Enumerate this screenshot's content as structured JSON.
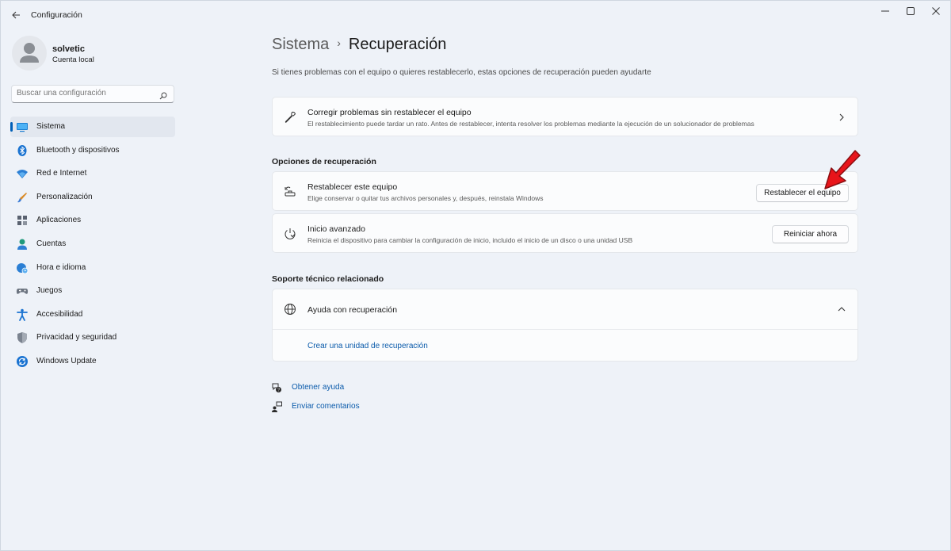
{
  "window": {
    "title": "Configuración"
  },
  "profile": {
    "name": "solvetic",
    "account_type": "Cuenta local"
  },
  "search": {
    "placeholder": "Buscar una configuración"
  },
  "sidebar": {
    "items": [
      {
        "label": "Sistema",
        "icon": "system-icon",
        "active": true
      },
      {
        "label": "Bluetooth y dispositivos",
        "icon": "bluetooth-icon"
      },
      {
        "label": "Red e Internet",
        "icon": "wifi-icon"
      },
      {
        "label": "Personalización",
        "icon": "brush-icon"
      },
      {
        "label": "Aplicaciones",
        "icon": "apps-icon"
      },
      {
        "label": "Cuentas",
        "icon": "account-icon"
      },
      {
        "label": "Hora e idioma",
        "icon": "globe-clock-icon"
      },
      {
        "label": "Juegos",
        "icon": "gamepad-icon"
      },
      {
        "label": "Accesibilidad",
        "icon": "accessibility-icon"
      },
      {
        "label": "Privacidad y seguridad",
        "icon": "shield-icon"
      },
      {
        "label": "Windows Update",
        "icon": "update-icon"
      }
    ]
  },
  "main": {
    "breadcrumb_parent": "Sistema",
    "breadcrumb_sep": "›",
    "page_title": "Recuperación",
    "subtitle": "Si tienes problemas con el equipo o quieres restablecerlo, estas opciones de recuperación pueden ayudarte",
    "fix_card": {
      "title": "Corregir problemas sin restablecer el equipo",
      "description": "El restablecimiento puede tardar un rato. Antes de restablecer, intenta resolver los problemas mediante la ejecución de un solucionador de problemas"
    },
    "recovery_options": {
      "heading": "Opciones de recuperación",
      "reset": {
        "title": "Restablecer este equipo",
        "description": "Elige conservar o quitar tus archivos personales y, después, reinstala Windows",
        "button": "Restablecer el equipo"
      },
      "advanced": {
        "title": "Inicio avanzado",
        "description": "Reinicia el dispositivo para cambiar la configuración de inicio, incluido el inicio de un disco o una unidad USB",
        "button": "Reiniciar ahora"
      }
    },
    "support": {
      "heading": "Soporte técnico relacionado",
      "help_title": "Ayuda con recuperación",
      "link": "Crear una unidad de recuperación"
    },
    "footer": {
      "get_help": "Obtener ayuda",
      "feedback": "Enviar comentarios"
    }
  },
  "colors": {
    "accent": "#005fb8",
    "annotation_arrow": "#e8141a",
    "link": "#0b5bab"
  }
}
